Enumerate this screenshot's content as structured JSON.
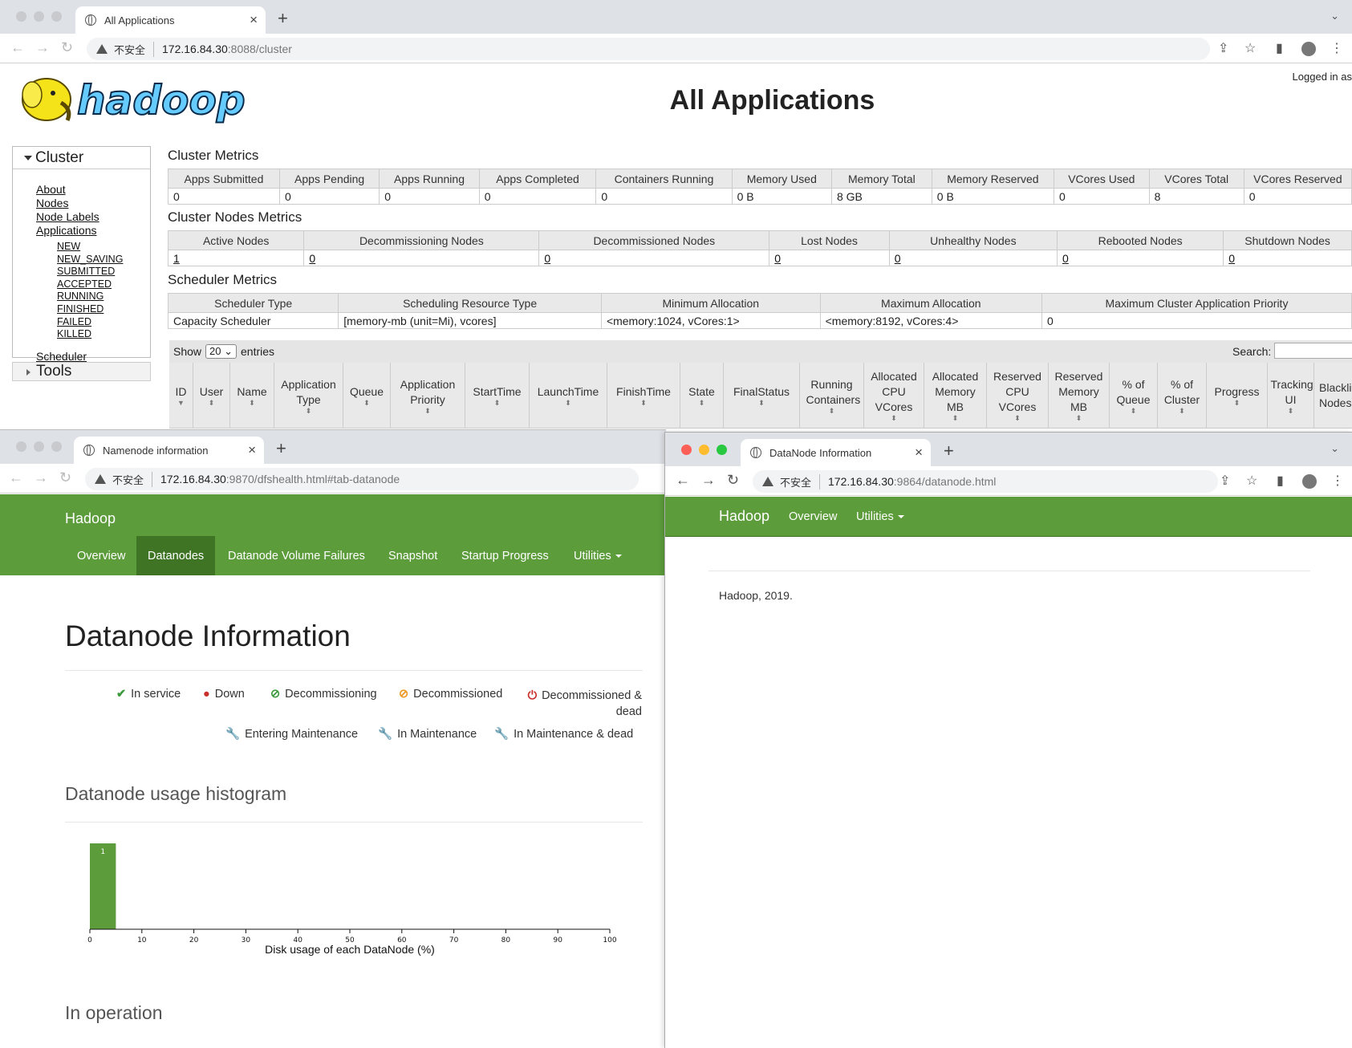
{
  "win1": {
    "tab_title": "All Applications",
    "insecure": "不安全",
    "host": "172.16.84.30",
    "path": ":8088/cluster",
    "page_title": "All Applications",
    "logged_in": "Logged in as",
    "nav": {
      "section": "Cluster",
      "links": [
        "About",
        "Nodes",
        "Node Labels",
        "Applications"
      ],
      "app_states": [
        "NEW",
        "NEW_SAVING",
        "SUBMITTED",
        "ACCEPTED",
        "RUNNING",
        "FINISHED",
        "FAILED",
        "KILLED"
      ],
      "scheduler": "Scheduler",
      "tools": "Tools"
    },
    "cluster_metrics": {
      "title": "Cluster Metrics",
      "headers": [
        "Apps Submitted",
        "Apps Pending",
        "Apps Running",
        "Apps Completed",
        "Containers Running",
        "Memory Used",
        "Memory Total",
        "Memory Reserved",
        "VCores Used",
        "VCores Total",
        "VCores Reserved"
      ],
      "values": [
        "0",
        "0",
        "0",
        "0",
        "0",
        "0 B",
        "8 GB",
        "0 B",
        "0",
        "8",
        "0"
      ]
    },
    "node_metrics": {
      "title": "Cluster Nodes Metrics",
      "headers": [
        "Active Nodes",
        "Decommissioning Nodes",
        "Decommissioned Nodes",
        "Lost Nodes",
        "Unhealthy Nodes",
        "Rebooted Nodes",
        "Shutdown Nodes"
      ],
      "values": [
        "1",
        "0",
        "0",
        "0",
        "0",
        "0",
        "0"
      ]
    },
    "scheduler_metrics": {
      "title": "Scheduler Metrics",
      "headers": [
        "Scheduler Type",
        "Scheduling Resource Type",
        "Minimum Allocation",
        "Maximum Allocation",
        "Maximum Cluster Application Priority"
      ],
      "values": [
        "Capacity Scheduler",
        "[memory-mb (unit=Mi), vcores]",
        "<memory:1024, vCores:1>",
        "<memory:8192, vCores:4>",
        "0"
      ]
    },
    "entries": {
      "show": "Show",
      "count": "20",
      "suffix": "entries",
      "search": "Search:"
    },
    "app_columns": [
      "ID",
      "User",
      "Name",
      "Application Type",
      "Queue",
      "Application Priority",
      "StartTime",
      "LaunchTime",
      "FinishTime",
      "State",
      "FinalStatus",
      "Running Containers",
      "Allocated CPU VCores",
      "Allocated Memory MB",
      "Reserved CPU VCores",
      "Reserved Memory MB",
      "% of Queue",
      "% of Cluster",
      "Progress",
      "Tracking UI",
      "Blacklisted Nodes"
    ]
  },
  "win2": {
    "tab_title": "Namenode information",
    "insecure": "不安全",
    "host": "172.16.84.30",
    "path": ":9870/dfshealth.html#tab-datanode",
    "brand": "Hadoop",
    "nav": [
      "Overview",
      "Datanodes",
      "Datanode Volume Failures",
      "Snapshot",
      "Startup Progress",
      "Utilities"
    ],
    "heading": "Datanode Information",
    "legend": [
      {
        "icon": "✔",
        "label": "In service",
        "color": "#3c9a3c"
      },
      {
        "icon": "●",
        "label": "Down",
        "color": "#c9302c"
      },
      {
        "icon": "⊘",
        "label": "Decommissioning",
        "color": "#3c9a3c"
      },
      {
        "icon": "⊘",
        "label": "Decommissioned",
        "color": "#ec971f"
      },
      {
        "icon": "⏻",
        "label": "Decommissioned & dead",
        "color": "#c9302c"
      },
      {
        "icon": "🔧",
        "label": "Entering Maintenance",
        "color": "#3c9a3c"
      },
      {
        "icon": "🔧",
        "label": "In Maintenance",
        "color": "#ec971f"
      },
      {
        "icon": "🔧",
        "label": "In Maintenance & dead",
        "color": "#c9302c"
      }
    ],
    "histogram_title": "Datanode usage histogram",
    "in_operation": "In operation"
  },
  "chart_data": {
    "type": "bar",
    "title": "",
    "xlabel": "Disk usage of each DataNode (%)",
    "ylabel": "",
    "xlim": [
      0,
      100
    ],
    "xticks": [
      0,
      10,
      20,
      30,
      40,
      50,
      60,
      70,
      80,
      90,
      100
    ],
    "bins": [
      {
        "x0": 0,
        "x1": 5,
        "count": 1
      }
    ],
    "bar_color": "#5c9c3b"
  },
  "win3": {
    "tab_title": "DataNode Information",
    "insecure": "不安全",
    "host": "172.16.84.30",
    "path": ":9864/datanode.html",
    "brand": "Hadoop",
    "nav": [
      "Overview",
      "Utilities"
    ],
    "footer": "Hadoop, 2019."
  }
}
